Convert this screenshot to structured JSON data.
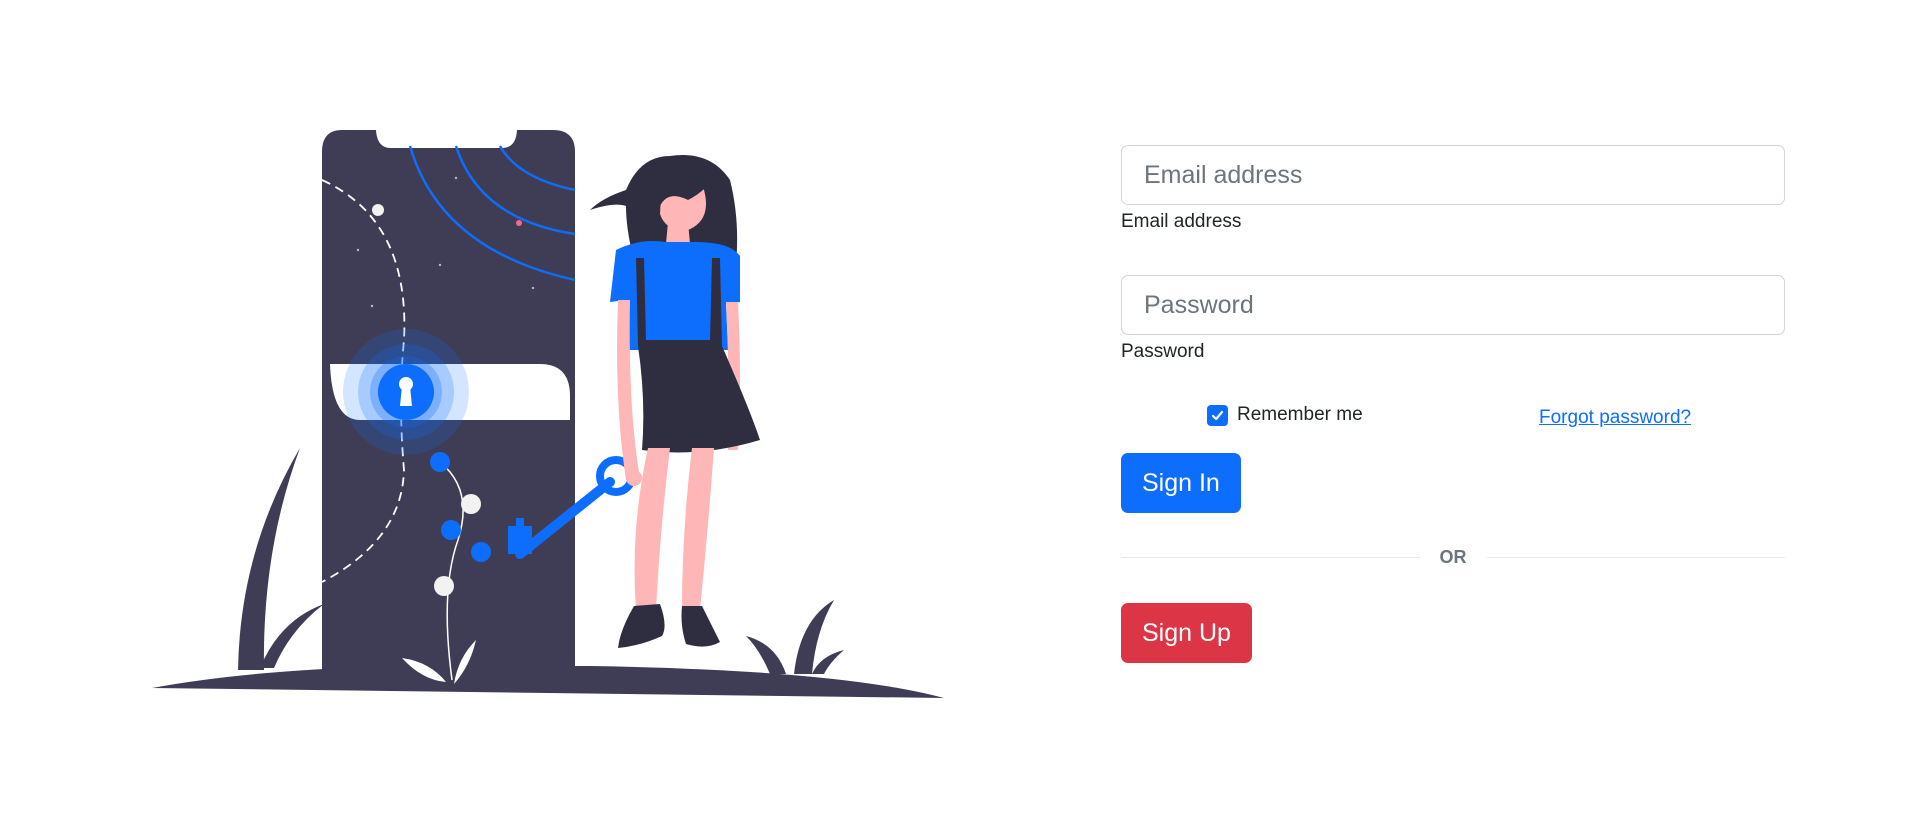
{
  "form": {
    "email": {
      "placeholder": "Email address",
      "value": "",
      "label": "Email address"
    },
    "password": {
      "placeholder": "Password",
      "value": "",
      "label": "Password"
    },
    "remember_me": {
      "label": "Remember me",
      "checked": true
    },
    "forgot_password_link": "Forgot password?",
    "sign_in_button": "Sign In",
    "divider_text": "OR",
    "sign_up_button": "Sign Up"
  },
  "illustration": {
    "icon": "phone-lock-key-woman-illustration"
  },
  "colors": {
    "primary": "#0d6efd",
    "danger": "#dc3545",
    "dark": "#3f3d56",
    "skin": "#ffb6b6"
  }
}
